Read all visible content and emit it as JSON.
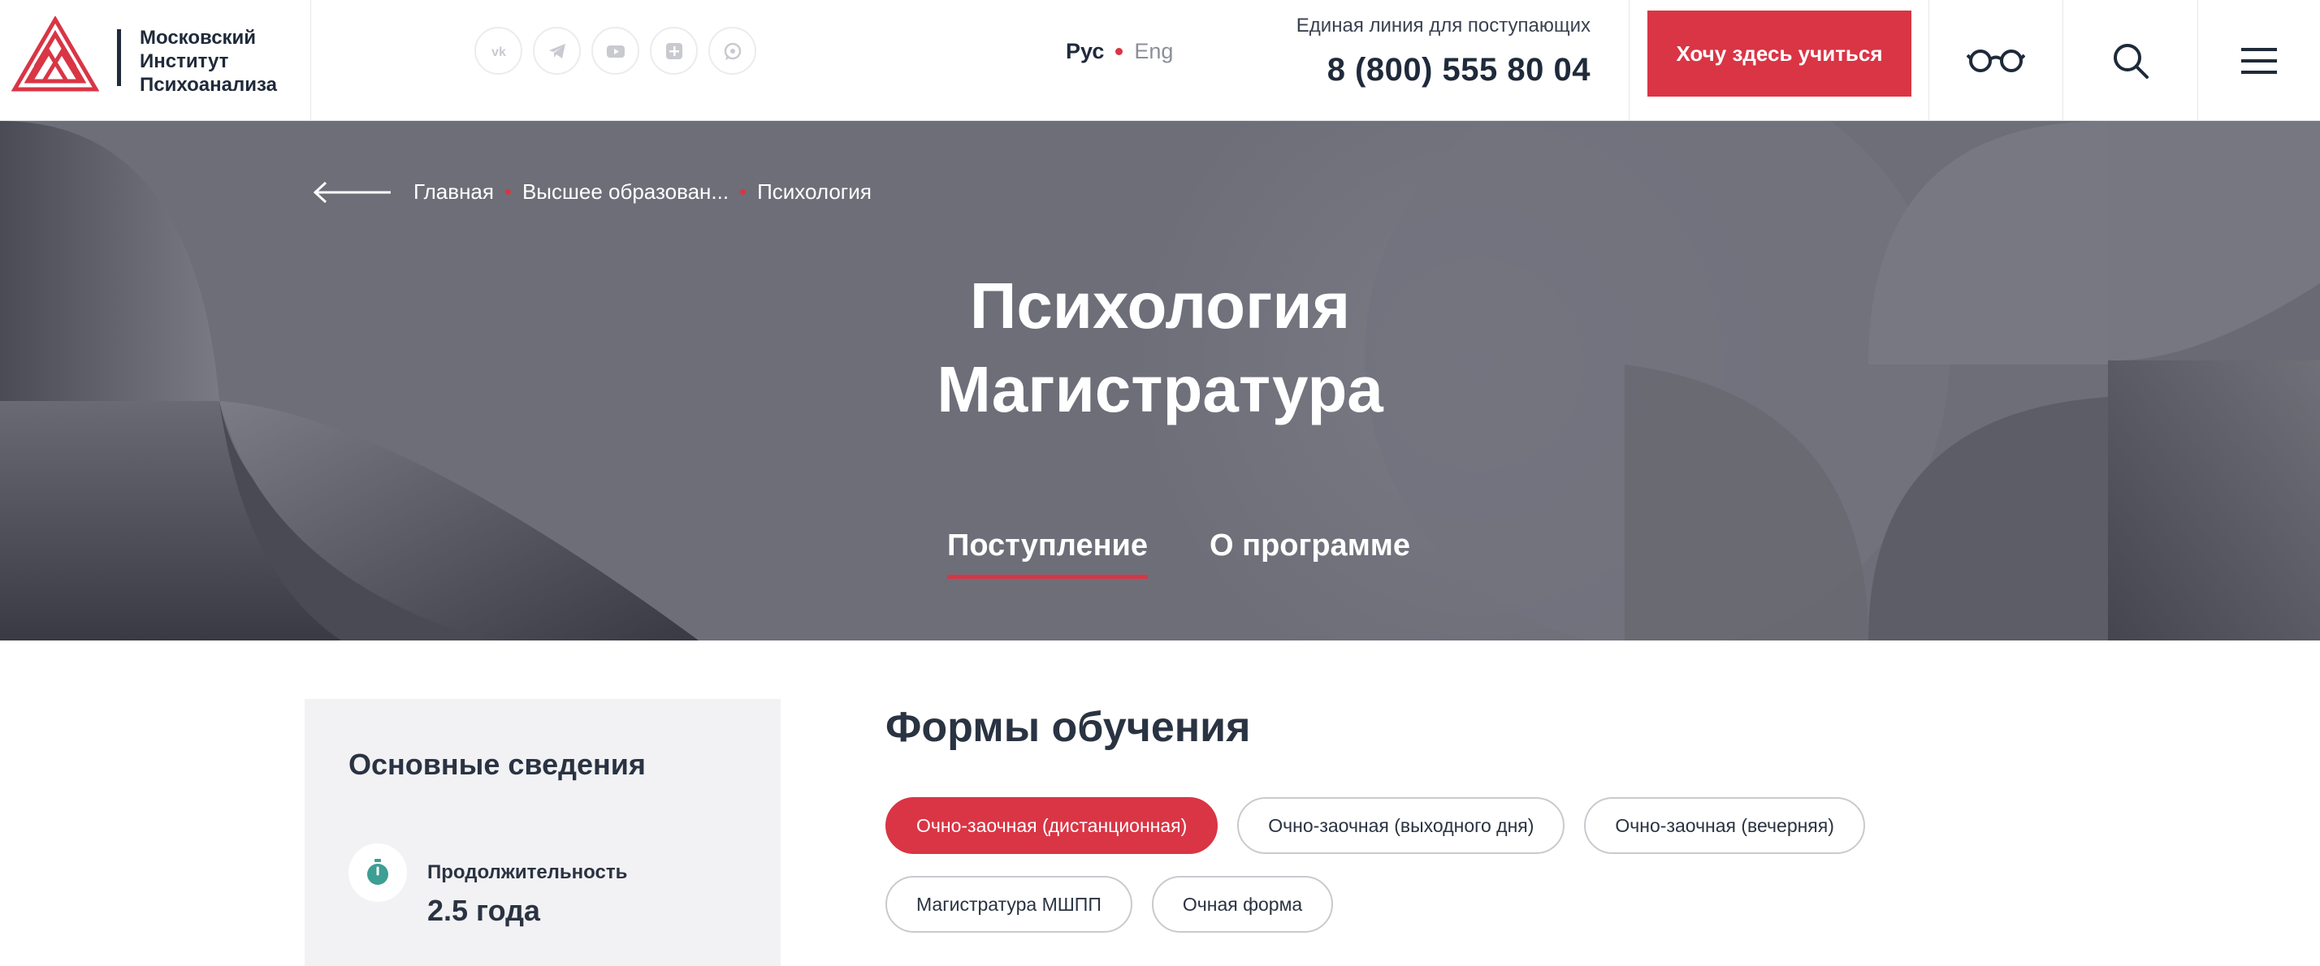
{
  "header": {
    "logo_lines": [
      "Московский",
      "Институт",
      "Психоанализа"
    ],
    "socials": [
      {
        "icon": "vk-icon"
      },
      {
        "icon": "telegram-icon"
      },
      {
        "icon": "youtube-icon"
      },
      {
        "icon": "plus-square-icon"
      },
      {
        "icon": "whatsapp-icon"
      }
    ],
    "lang": {
      "ru": "Рус",
      "en": "Eng"
    },
    "hotline_label": "Единая линия для поступающих",
    "hotline_phone": "8 (800) 555 80 04",
    "cta_label": "Хочу здесь учиться",
    "accent_color": "#d93545"
  },
  "breadcrumb": {
    "items": [
      "Главная",
      "Высшее образован...",
      "Психология"
    ]
  },
  "hero": {
    "title_lines": [
      "Психология",
      "Магистратура"
    ],
    "tabs": [
      {
        "label": "Поступление",
        "active": true
      },
      {
        "label": "О программе",
        "active": false
      }
    ]
  },
  "info_card": {
    "title": "Основные сведения",
    "duration_label": "Продолжительность",
    "duration_value": "2.5 года"
  },
  "study_forms": {
    "title": "Формы обучения",
    "options": [
      {
        "label": "Очно-заочная (дистанционная)",
        "active": true
      },
      {
        "label": "Очно-заочная (выходного дня)",
        "active": false
      },
      {
        "label": "Очно-заочная (вечерняя)",
        "active": false
      },
      {
        "label": "Магистратура МШПП",
        "active": false
      },
      {
        "label": "Очная форма",
        "active": false
      }
    ]
  }
}
